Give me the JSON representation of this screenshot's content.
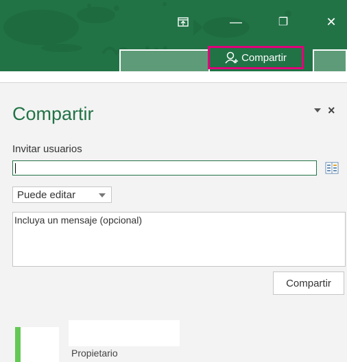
{
  "window": {
    "controls": [
      {
        "name": "ribbon-display-icon"
      },
      {
        "name": "minimize-icon",
        "glyph": "—"
      },
      {
        "name": "restore-icon",
        "glyph": "❐"
      },
      {
        "name": "close-icon",
        "glyph": "✕"
      }
    ],
    "share_button_label": "Compartir",
    "accent_color": "#217346",
    "highlight_color": "#e2007a"
  },
  "pane": {
    "title": "Compartir",
    "close_glyph": "×",
    "invite_label": "Invitar usuarios",
    "invite_value": "",
    "permission_selected": "Puede editar",
    "message_placeholder": "Incluya un mensaje (opcional)",
    "share_action_label": "Compartir",
    "owner_role": "Propietario"
  }
}
